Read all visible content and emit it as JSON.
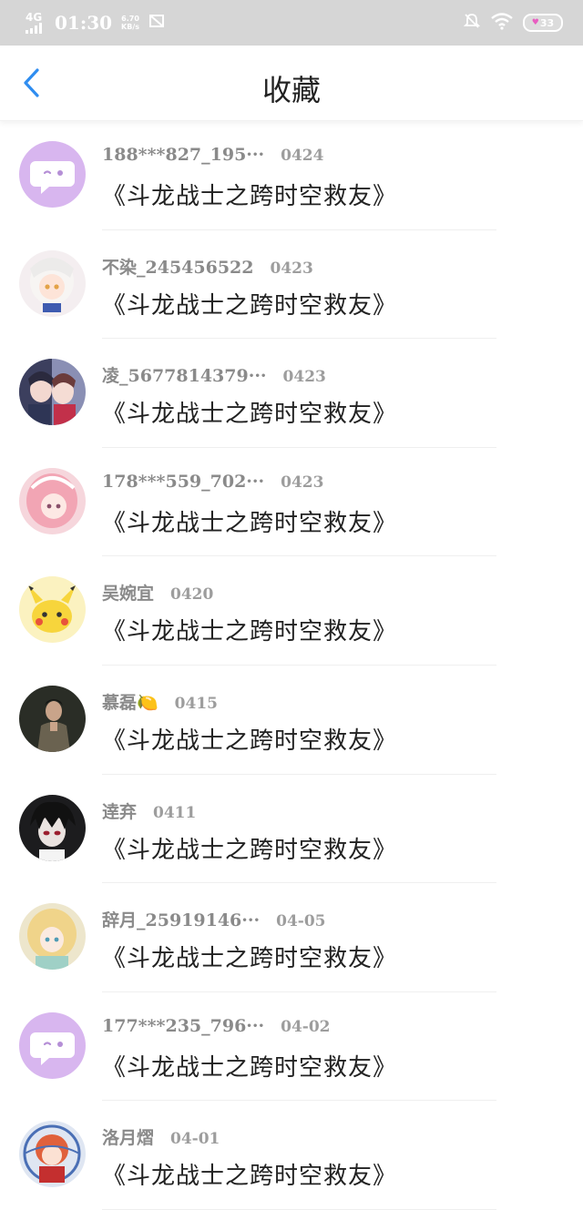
{
  "status_bar": {
    "network": "4G",
    "time": "01:30",
    "speed_value": "6.70",
    "speed_unit": "KB/s",
    "battery": "33"
  },
  "nav": {
    "title": "收藏"
  },
  "items": [
    {
      "user": "188***827_195···",
      "date": "0424",
      "book": "《斗龙战士之跨时空救友》",
      "avatar": "default"
    },
    {
      "user": "不染_245456522",
      "date": "0423",
      "book": "《斗龙战士之跨时空救友》",
      "avatar": "white-hair-girl"
    },
    {
      "user": "凌_5677814379···",
      "date": "0423",
      "book": "《斗龙战士之跨时空救友》",
      "avatar": "dark-couple"
    },
    {
      "user": "178***559_702···",
      "date": "0423",
      "book": "《斗龙战士之跨时空救友》",
      "avatar": "pink-hair-girl"
    },
    {
      "user": "吴婉宜",
      "date": "0420",
      "book": "《斗龙战士之跨时空救友》",
      "avatar": "pikachu"
    },
    {
      "user": "慕磊🍋",
      "date": "0415",
      "book": "《斗龙战士之跨时空救友》",
      "avatar": "man-photo"
    },
    {
      "user": "逹弃",
      "date": "0411",
      "book": "《斗龙战士之跨时空救友》",
      "avatar": "dark-hair-boy"
    },
    {
      "user": "辞月_25919146···",
      "date": "04-05",
      "book": "《斗龙战士之跨时空救友》",
      "avatar": "blonde-girl"
    },
    {
      "user": "177***235_796···",
      "date": "04-02",
      "book": "《斗龙战士之跨时空救友》",
      "avatar": "default"
    },
    {
      "user": "洛月熠",
      "date": "04-01",
      "book": "《斗龙战士之跨时空救友》",
      "avatar": "red-girl"
    }
  ],
  "colors": {
    "accent": "#2f8df0",
    "default_avatar": "#d8b6ef",
    "status_bar_bg": "#d6d6d6"
  }
}
